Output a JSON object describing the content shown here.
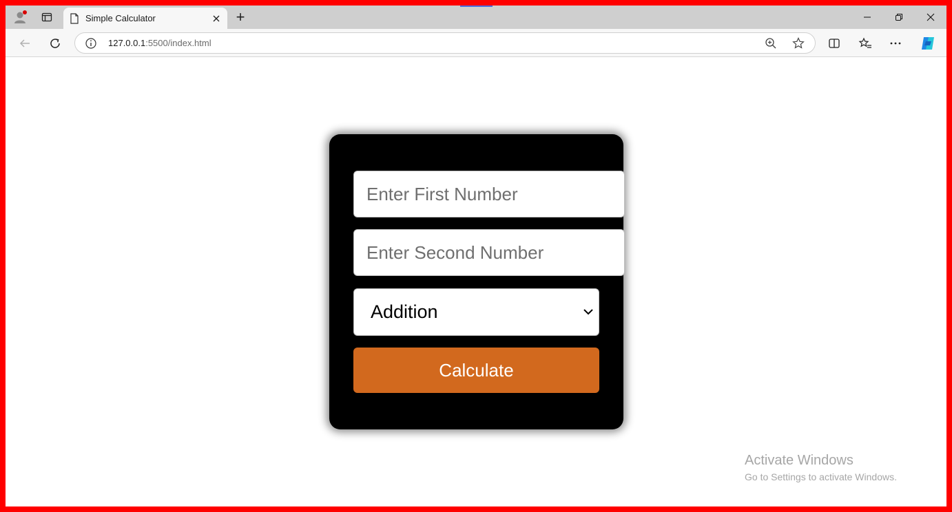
{
  "browser": {
    "tab": {
      "title": "Simple Calculator"
    },
    "address": {
      "host": "127.0.0.1",
      "path": ":5500/index.html"
    },
    "new_tab_label": "+"
  },
  "page": {
    "form": {
      "first_number_placeholder": "Enter First Number",
      "second_number_placeholder": "Enter Second Number",
      "operation_selected": "Addition",
      "calculate_label": "Calculate"
    }
  },
  "watermark": {
    "title": "Activate Windows",
    "subtitle": "Go to Settings to activate Windows."
  },
  "colors": {
    "frame_border": "#ff0000",
    "card_background": "#000000",
    "calculate_button": "#d2691e"
  },
  "icons": [
    "profile-icon",
    "tab-actions-icon",
    "page-icon",
    "close-icon",
    "minimize-icon",
    "restore-icon",
    "window-close-icon",
    "back-icon",
    "refresh-icon",
    "info-icon",
    "zoom-icon",
    "favorite-star-icon",
    "split-screen-icon",
    "favorites-icon",
    "more-icon",
    "copilot-icon",
    "chevron-down-icon"
  ]
}
